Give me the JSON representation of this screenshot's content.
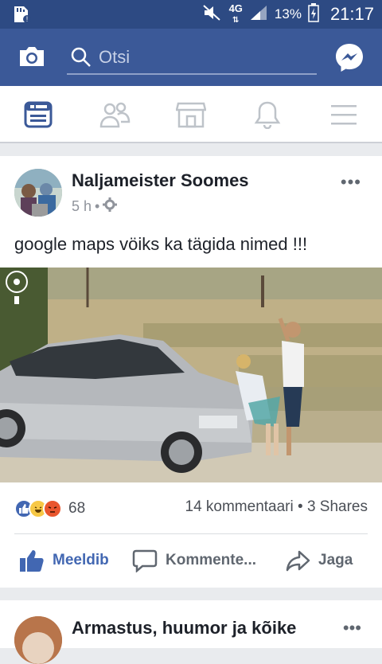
{
  "status_bar": {
    "network": "4G",
    "battery": "13%",
    "time": "21:17"
  },
  "top_bar": {
    "search_placeholder": "Otsi"
  },
  "nav_tabs": [
    "news-feed-icon",
    "friends-icon",
    "marketplace-icon",
    "notifications-icon",
    "menu-icon"
  ],
  "post": {
    "author": "Naljameister Soomes",
    "time": "5 h",
    "separator": "•",
    "text": "google maps vöiks ka tägida nimed !!!",
    "reaction_count": "68",
    "comments": "14 kommentaari",
    "stats_separator": "•",
    "shares": "3 Shares",
    "actions": {
      "like": "Meeldib",
      "comment": "Kommente...",
      "share": "Jaga"
    }
  },
  "next_post": {
    "author": "Armastus, huumor ja kõike"
  },
  "colors": {
    "brand": "#3b5998",
    "status_bar": "#2d4a83",
    "like_blue": "#4267b2"
  }
}
